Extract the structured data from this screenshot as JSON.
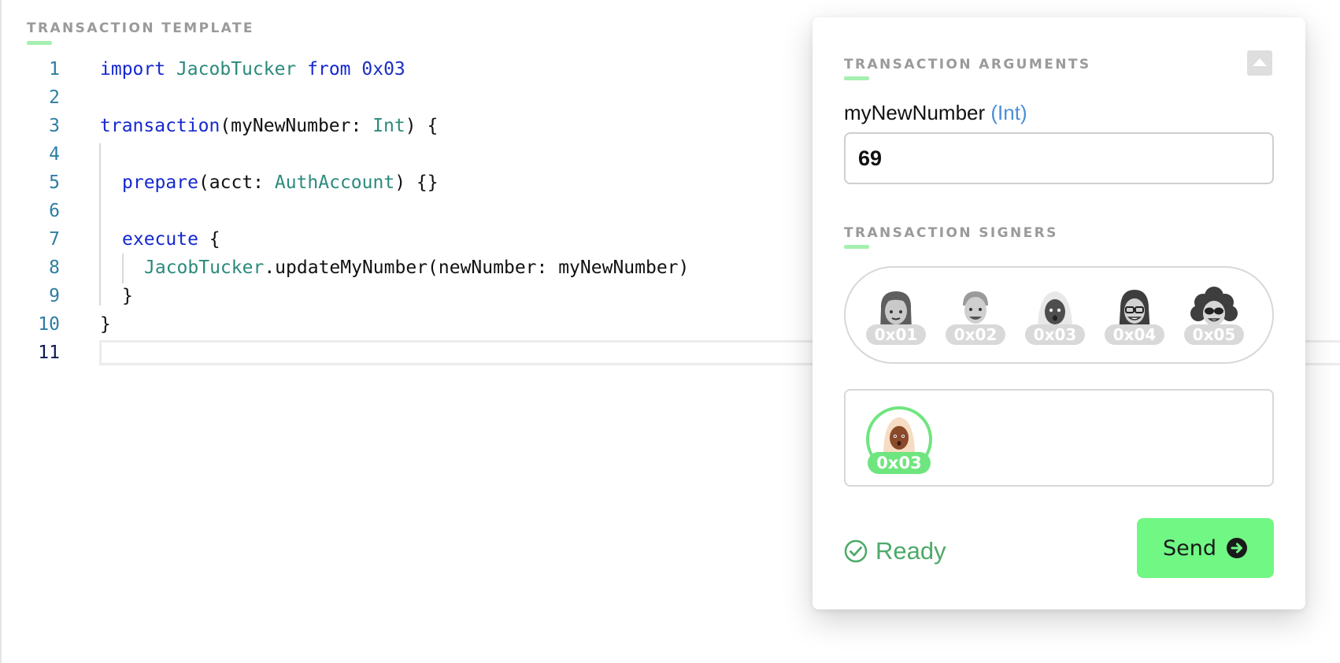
{
  "editor": {
    "section_label": "TRANSACTION TEMPLATE",
    "line_numbers": [
      "1",
      "2",
      "3",
      "4",
      "5",
      "6",
      "7",
      "8",
      "9",
      "10",
      "11"
    ],
    "tokens": {
      "l1_kw1": "import",
      "l1_ty1": "JacobTucker",
      "l1_kw2": "from",
      "l1_num": "0x03",
      "l3_kw": "transaction",
      "l3_a": "(myNewNumber: ",
      "l3_ty": "Int",
      "l3_b": ") {",
      "l5_kw": "prepare",
      "l5_a": "(acct: ",
      "l5_ty": "AuthAccount",
      "l5_b": ") {}",
      "l7_kw": "execute",
      "l7_a": " {",
      "l8_ty": "JacobTucker",
      "l8_a": ".updateMyNumber(newNumber: myNewNumber)",
      "l9": "}",
      "l10": "}"
    }
  },
  "panel": {
    "arguments_label": "TRANSACTION ARGUMENTS",
    "arg": {
      "name": "myNewNumber",
      "type": "(Int)",
      "value": "69"
    },
    "signers_label": "TRANSACTION SIGNERS",
    "accounts": [
      "0x01",
      "0x02",
      "0x03",
      "0x04",
      "0x05"
    ],
    "selected_signer": "0x03",
    "status": "Ready",
    "send_label": "Send",
    "icons": {
      "collapse": "caret-up-icon",
      "status": "check-circle-icon",
      "send": "arrow-right-circle-icon"
    },
    "colors": {
      "accent_green": "#70f784",
      "ready_green": "#4caa68",
      "type_blue": "#4a8fd8"
    }
  }
}
